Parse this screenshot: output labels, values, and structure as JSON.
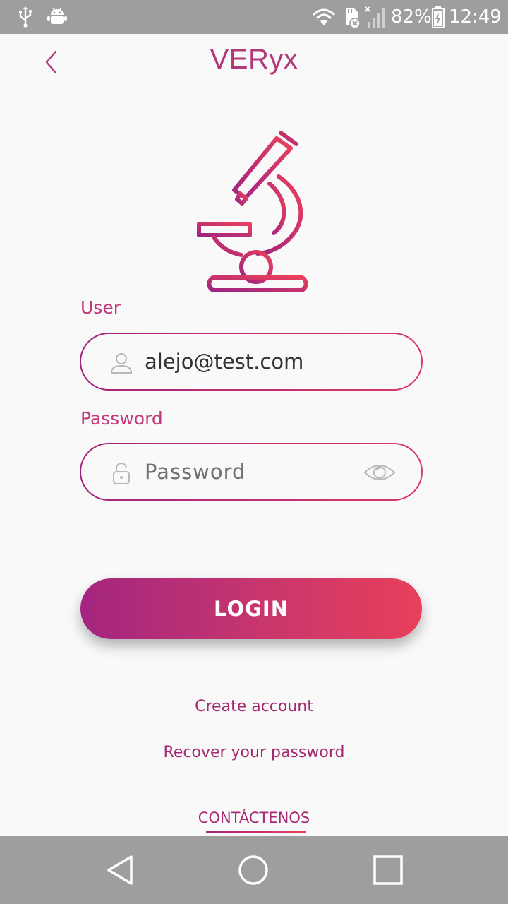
{
  "status_bar": {
    "battery_text": "82%",
    "time": "12:49",
    "icons": [
      "usb-icon",
      "android-debug-icon",
      "wifi-icon",
      "sd-card-icon",
      "no-signal-icon",
      "battery-charging-icon"
    ]
  },
  "header": {
    "title": "VERyx",
    "back_icon": "chevron-left-icon"
  },
  "logo": {
    "icon": "microscope-icon"
  },
  "form": {
    "user_label": "User",
    "user_value": "alejo@test.com",
    "password_label": "Password",
    "password_placeholder": "Password",
    "login_label": "LOGIN"
  },
  "links": {
    "create_account": "Create account",
    "recover_password": "Recover your password",
    "contact": "CONTÁCTENOS"
  },
  "colors": {
    "accent_start": "#a3237f",
    "accent_end": "#e8405a",
    "bars": "#9e9e9e"
  }
}
